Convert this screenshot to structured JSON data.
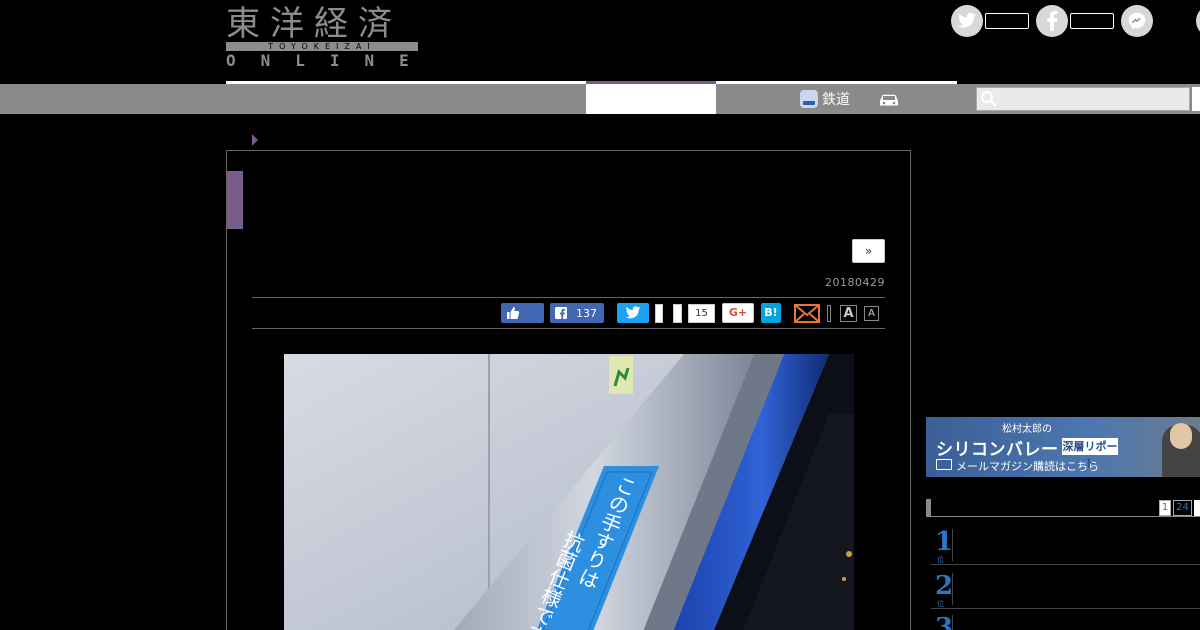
{
  "logo": {
    "kanji": "東洋経済",
    "romaji": "TOYOKEIZAI",
    "online": "ONLINE"
  },
  "nav": {
    "rail_label": "鉄道",
    "search_placeholder": ""
  },
  "article": {
    "more_label": "»",
    "date": "20180429",
    "share": {
      "facebook_count": "137",
      "pocket_count": "15",
      "googleplus_label": "G+",
      "hatena_label": "B!"
    },
    "font_size_large": "A",
    "font_size_small": "A",
    "photo_sign_line1": "この手すりは",
    "photo_sign_line2": "抗菌仕様です"
  },
  "sidebar": {
    "banner": {
      "small": "松村太郎の",
      "big": "シリコンバレー",
      "tag": "深層リポート",
      "sub": "メールマガジン購読はこちら"
    },
    "ranking_tabs": [
      "1",
      "24"
    ],
    "ranks": [
      {
        "num": "1",
        "suffix": "位"
      },
      {
        "num": "2",
        "suffix": "位"
      },
      {
        "num": "3",
        "suffix": "位"
      }
    ]
  },
  "colors": {
    "accent": "#7a5c8c",
    "nav_gray": "#8a8a8a",
    "rank_blue": "#2c75c2",
    "facebook": "#4267b2",
    "twitter": "#1da1f2",
    "hatena": "#00a4de"
  }
}
